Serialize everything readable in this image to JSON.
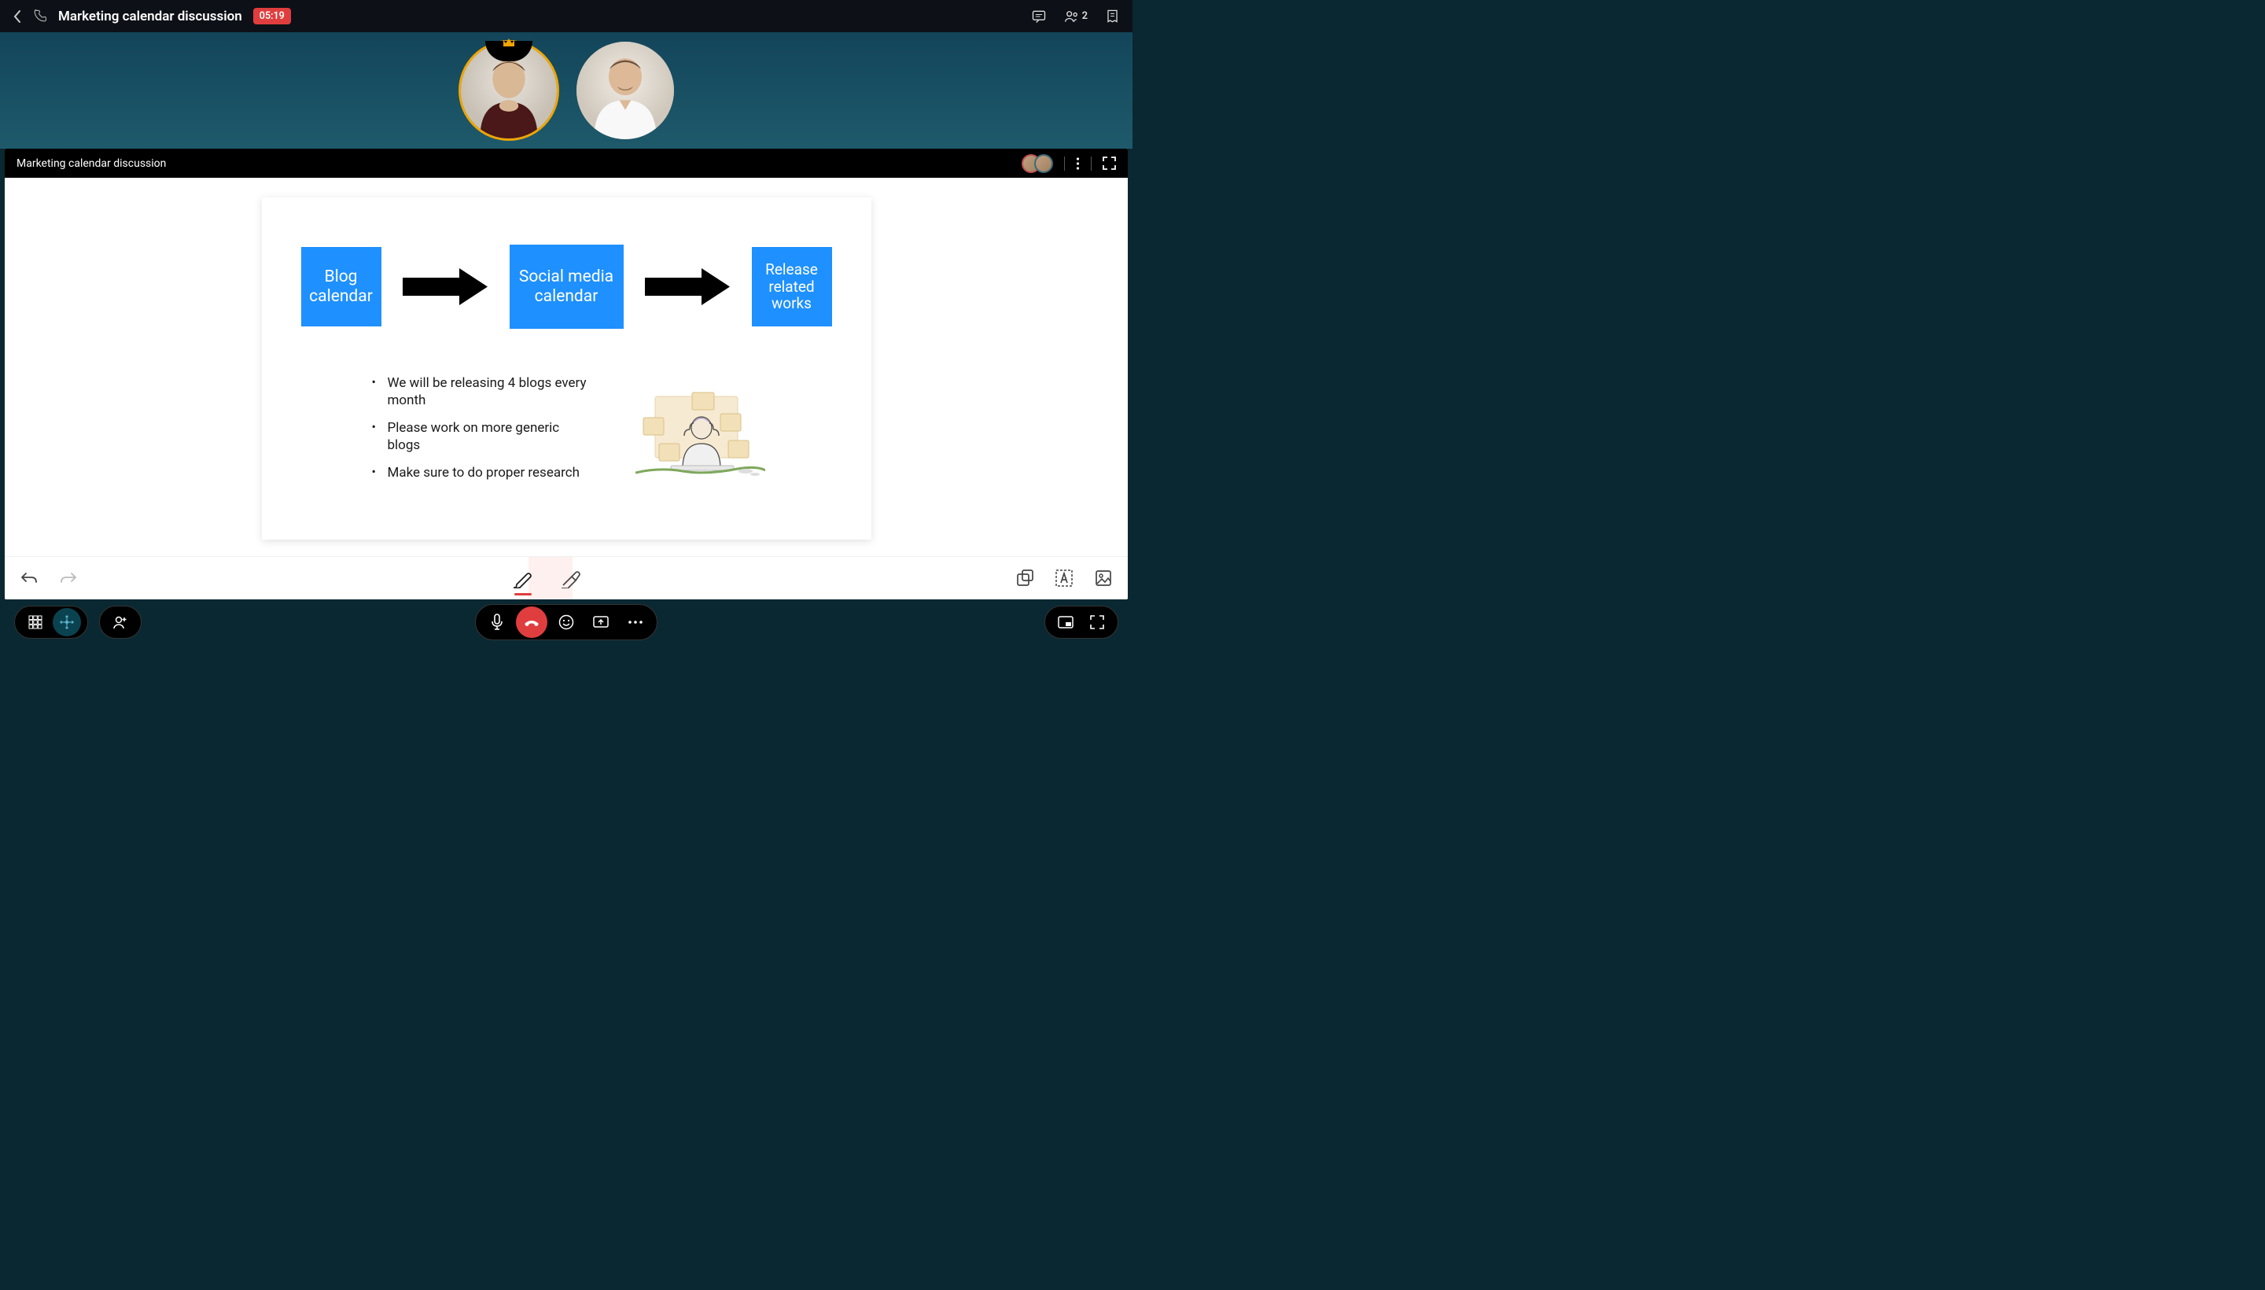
{
  "header": {
    "title": "Marketing calendar discussion",
    "timer": "05:19",
    "participant_count": "2"
  },
  "share": {
    "title": "Marketing calendar discussion"
  },
  "slide": {
    "box1": "Blog calendar",
    "box2": "Social media calendar",
    "box3": "Release related works",
    "bullets": [
      "We will be releasing 4 blogs every month",
      "Please work on more generic blogs",
      "Make sure to do proper research"
    ]
  }
}
